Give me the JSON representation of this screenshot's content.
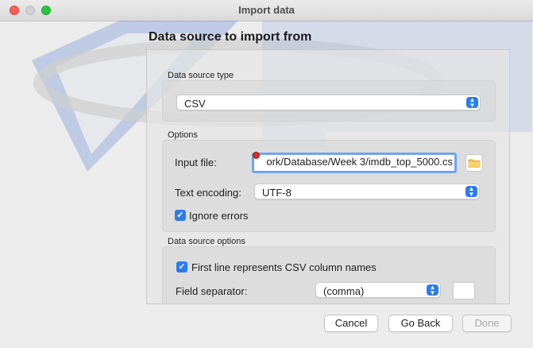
{
  "window": {
    "title": "Import data"
  },
  "heading": "Data source to import from",
  "data_source_type": {
    "label": "Data source type",
    "selected": "CSV"
  },
  "options": {
    "label": "Options",
    "input_file": {
      "label": "Input file:",
      "value": "ork/Database/Week 3/imdb_top_5000.cs"
    },
    "text_encoding": {
      "label": "Text encoding:",
      "selected": "UTF-8"
    },
    "ignore_errors": {
      "label": "Ignore errors",
      "checked": true
    }
  },
  "data_source_options": {
    "label": "Data source options",
    "first_line": {
      "label": "First line represents CSV column names",
      "checked": true
    },
    "field_separator": {
      "label": "Field separator:",
      "selected": "(comma)"
    }
  },
  "buttons": {
    "cancel": "Cancel",
    "go_back": "Go Back",
    "done": "Done"
  },
  "icons": {
    "stepper": "up-down-chevron-icon",
    "folder": "folder-icon",
    "check": "checkmark-icon",
    "error": "error-dot-icon"
  },
  "colors": {
    "accent": "#2a7bf4",
    "focus_ring": "#6fa3f0",
    "close": "#fe5f57",
    "maximize": "#27c840",
    "folder": "#f2c14e",
    "watermark": "#6f8fd6"
  }
}
